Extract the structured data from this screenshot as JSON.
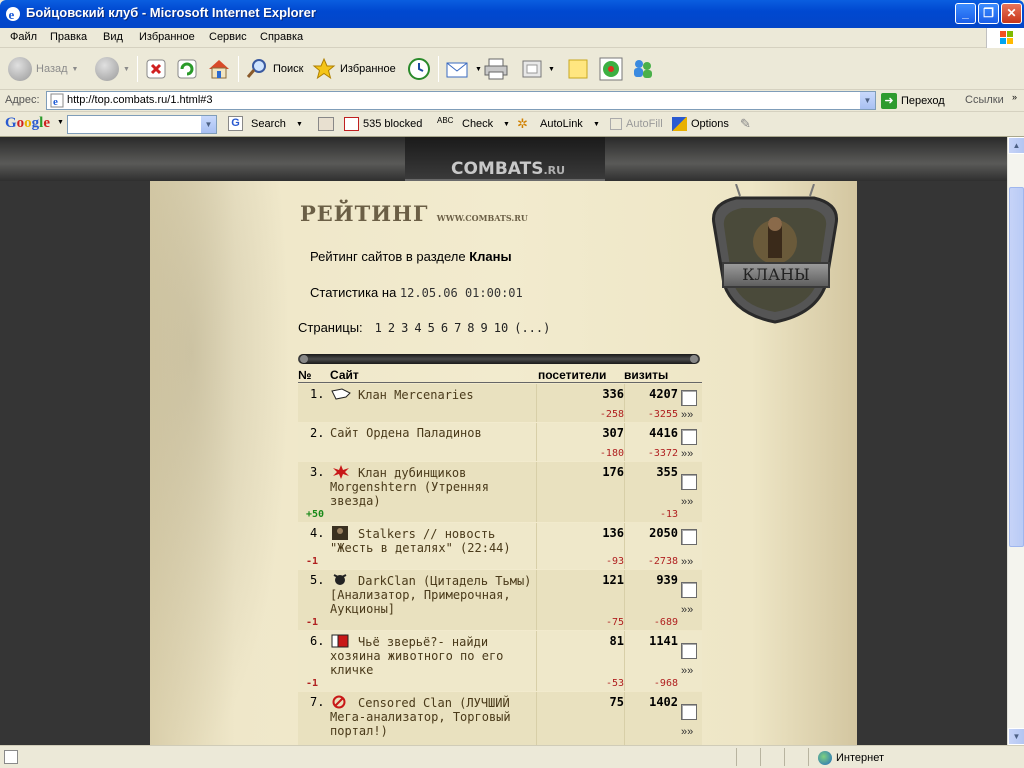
{
  "window": {
    "title": "Бойцовский клуб - Microsoft Internet Explorer",
    "min_label": "_",
    "max_label": "❐",
    "close_label": "✕"
  },
  "menu": [
    "Файл",
    "Правка",
    "Вид",
    "Избранное",
    "Сервис",
    "Справка"
  ],
  "toolbar": {
    "back": "Назад",
    "search": "Поиск",
    "favorites": "Избранное"
  },
  "address": {
    "label": "Адрес:",
    "url": "http://top.combats.ru/1.html#3",
    "go": "Переход",
    "links": "Ссылки"
  },
  "google": {
    "logo": "Google",
    "search_btn": "Search",
    "blocked": "535 blocked",
    "check": "Check",
    "autolink": "AutoLink",
    "autofill": "AutoFill",
    "options": "Options"
  },
  "page": {
    "logo_text": "COMBATS",
    "logo_ru": ".RU",
    "heading": "РЕЙТИНГ",
    "heading_sub": "WWW.COMBATS.RU",
    "badge": "КЛАНЫ",
    "intro_prefix": "Рейтинг сайтов в разделе ",
    "intro_section": "Кланы",
    "stat_prefix": "Статистика на ",
    "stat_time": "12.05.06 01:00:01",
    "pages_label": "Страницы:",
    "pages": [
      "1",
      "2",
      "3",
      "4",
      "5",
      "6",
      "7",
      "8",
      "9",
      "10",
      "(...)"
    ],
    "columns": {
      "num": "№",
      "site": "Сайт",
      "visitors": "посетители",
      "visits": "визиты"
    },
    "rows": [
      {
        "num": "1.",
        "site": "Клан Mercenaries",
        "visitors": "336",
        "visits": "4207",
        "vis_delta": "-258",
        "hit_delta": "-3255",
        "pos_delta": "",
        "icon": "hand-icon"
      },
      {
        "num": "2.",
        "site": "Сайт Ордена Паладинов",
        "visitors": "307",
        "visits": "4416",
        "vis_delta": "-180",
        "hit_delta": "-3372",
        "pos_delta": "",
        "icon": ""
      },
      {
        "num": "3.",
        "site": "Клан дубинщиков Morgenshtern (Утренняя звезда)",
        "visitors": "176",
        "visits": "355",
        "vis_delta": "",
        "hit_delta": "-13",
        "pos_delta": "+50",
        "icon": "star-icon"
      },
      {
        "num": "4.",
        "site": "Stalkers // новость \"Жесть в деталях\" (22:44)",
        "visitors": "136",
        "visits": "2050",
        "vis_delta": "-93",
        "hit_delta": "-2738",
        "pos_delta": "-1",
        "icon": "stalker-icon"
      },
      {
        "num": "5.",
        "site": "DarkClan (Цитадель Тьмы) [Анализатор, Примерочная, Аукционы]",
        "visitors": "121",
        "visits": "939",
        "vis_delta": "-75",
        "hit_delta": "-689",
        "pos_delta": "-1",
        "icon": "dark-icon"
      },
      {
        "num": "6.",
        "site": "Чьё зверьё?- найди хозяина животного по его кличке",
        "visitors": "81",
        "visits": "1141",
        "vis_delta": "-53",
        "hit_delta": "-968",
        "pos_delta": "-1",
        "icon": "cards-icon"
      },
      {
        "num": "7.",
        "site": "Censored Clan (ЛУЧШИЙ Мега-анализатор, Торговый портал!)",
        "visitors": "75",
        "visits": "1402",
        "vis_delta": "",
        "hit_delta": "",
        "pos_delta": "",
        "icon": "forbidden-icon"
      }
    ],
    "raquo": "»»"
  },
  "status": {
    "zone": "Интернет"
  }
}
